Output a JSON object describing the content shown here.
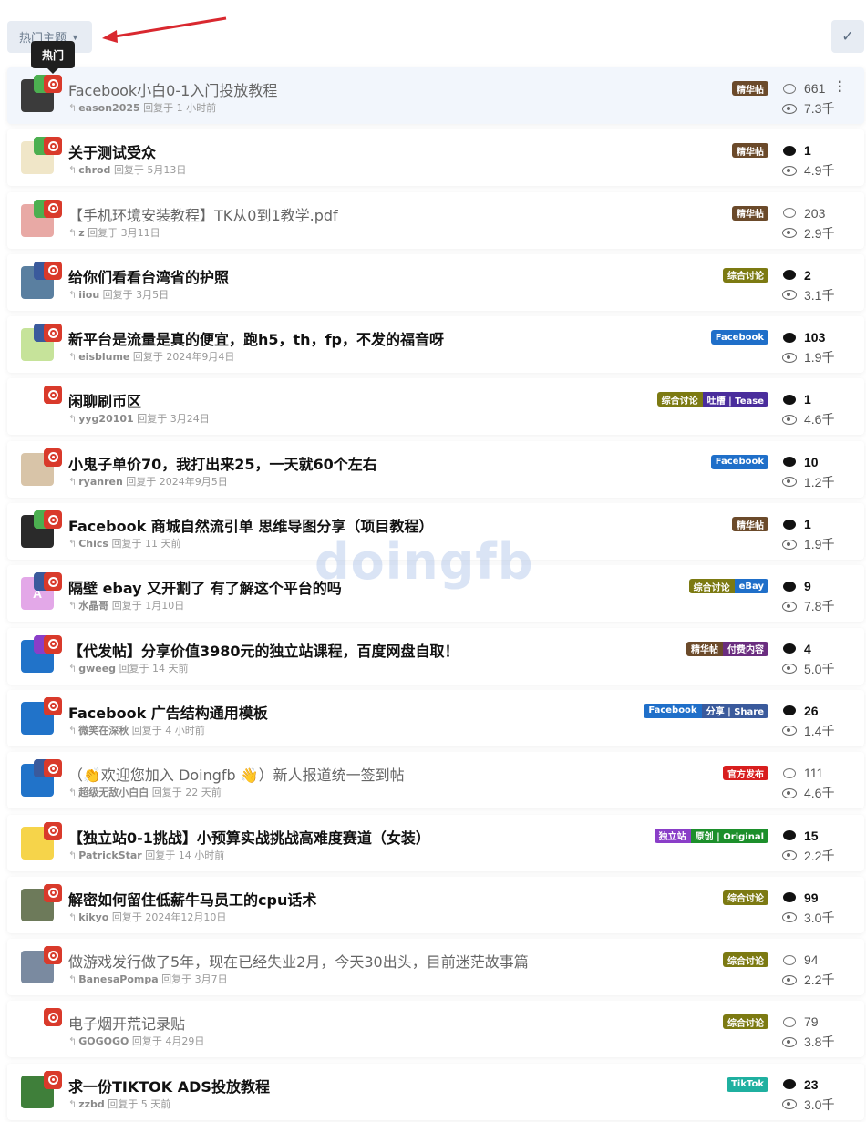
{
  "toolbar": {
    "sort_label": "热门主题",
    "tooltip": "热门"
  },
  "watermark": "doingfb",
  "colors": {
    "hot_badge": "#d93a2b",
    "tag_jinghua": "#6b4a2a",
    "tag_zonghe": "#7c7a12",
    "tag_facebook": "#1f6fc9",
    "tag_tucao": "#4a2d9c",
    "tag_paid": "#6a2d7f",
    "tag_share": "#3a5a9c",
    "tag_ebay": "#1f6fc9",
    "tag_official": "#d81e1e",
    "tag_standalone": "#8a3ec8",
    "tag_original": "#1c8f2b",
    "tag_tiktok": "#1fb0a0"
  },
  "topics": [
    {
      "title": "Facebook小白0-1入门投放教程",
      "user": "eason2025",
      "time": "回复于 1 小时前",
      "tags": [
        "精华帖"
      ],
      "replies": "661",
      "views": "7.3千",
      "read": true,
      "b1": "#4caf50"
    },
    {
      "title": "关于测试受众",
      "user": "chrod",
      "time": "回复于 5月13日",
      "tags": [
        "精华帖"
      ],
      "replies": "1",
      "views": "4.9千",
      "read": false,
      "b1": "#4caf50"
    },
    {
      "title": "【手机环境安装教程】TK从0到1教学.pdf",
      "user": "z",
      "time": "回复于 3月11日",
      "tags": [
        "精华帖"
      ],
      "replies": "203",
      "views": "2.9千",
      "read": true,
      "b1": "#4caf50"
    },
    {
      "title": "给你们看看台湾省的护照",
      "user": "iiou",
      "time": "回复于 3月5日",
      "tags": [
        "综合讨论"
      ],
      "replies": "2",
      "views": "3.1千",
      "read": false,
      "b1": "#3a5a9c"
    },
    {
      "title": "新平台是流量是真的便宜，跑h5，th，fp，不发的福音呀",
      "user": "eisblume",
      "time": "回复于 2024年9月4日",
      "tags": [
        "Facebook"
      ],
      "replies": "103",
      "views": "1.9千",
      "read": false,
      "b1": "#3a5a9c"
    },
    {
      "title": "闲聊刷币区",
      "user": "yyg20101",
      "time": "回复于 3月24日",
      "tags": [
        "综合讨论",
        "吐槽 | Tease"
      ],
      "replies": "1",
      "views": "4.6千",
      "read": false,
      "b1": ""
    },
    {
      "title": "小鬼子单价70，我打出来25，一天就60个左右",
      "user": "ryanren",
      "time": "回复于 2024年9月5日",
      "tags": [
        "Facebook"
      ],
      "replies": "10",
      "views": "1.2千",
      "read": false,
      "b1": ""
    },
    {
      "title": "Facebook 商城自然流引单 思维导图分享（项目教程）",
      "user": "Chics",
      "time": "回复于 11 天前",
      "tags": [
        "精华帖"
      ],
      "replies": "1",
      "views": "1.9千",
      "read": false,
      "b1": "#4caf50"
    },
    {
      "title": "隔壁 ebay 又开割了 有了解这个平台的吗",
      "user": "水晶哥",
      "time": "回复于 1月10日",
      "tags": [
        "综合讨论",
        "eBay"
      ],
      "replies": "9",
      "views": "7.8千",
      "read": false,
      "b1": "#3a5a9c"
    },
    {
      "title": "【代发帖】分享价值3980元的独立站课程，百度网盘自取！",
      "user": "gweeg",
      "time": "回复于 14 天前",
      "tags": [
        "精华帖",
        "付费内容"
      ],
      "replies": "4",
      "views": "5.0千",
      "read": false,
      "b1": "#8a3ec8"
    },
    {
      "title": "Facebook 广告结构通用模板",
      "user": "微笑在深秋",
      "time": "回复于 4 小时前",
      "tags": [
        "Facebook",
        "分享 | Share"
      ],
      "replies": "26",
      "views": "1.4千",
      "read": false,
      "b1": ""
    },
    {
      "title": "（👏欢迎您加入 Doingfb 👋）新人报道统一签到帖",
      "user": "超级无敌小白白",
      "time": "回复于 22 天前",
      "tags": [
        "官方发布"
      ],
      "replies": "111",
      "views": "4.6千",
      "read": true,
      "b1": "#3a5a9c"
    },
    {
      "title": "【独立站0-1挑战】小预算实战挑战高难度赛道（女装）",
      "user": "PatrickStar",
      "time": "回复于 14 小时前",
      "tags": [
        "独立站",
        "原创 | Original"
      ],
      "replies": "15",
      "views": "2.2千",
      "read": false,
      "b1": ""
    },
    {
      "title": "解密如何留住低薪牛马员工的cpu话术",
      "user": "kikyo",
      "time": "回复于 2024年12月10日",
      "tags": [
        "综合讨论"
      ],
      "replies": "99",
      "views": "3.0千",
      "read": false,
      "b1": ""
    },
    {
      "title": "做游戏发行做了5年，现在已经失业2月，今天30出头，目前迷茫故事篇",
      "user": "BanesaPompa",
      "time": "回复于 3月7日",
      "tags": [
        "综合讨论"
      ],
      "replies": "94",
      "views": "2.2千",
      "read": true,
      "b1": ""
    },
    {
      "title": "电子烟开荒记录贴",
      "user": "GOGOGO",
      "time": "回复于 4月29日",
      "tags": [
        "综合讨论"
      ],
      "replies": "79",
      "views": "3.8千",
      "read": true,
      "b1": ""
    },
    {
      "title": "求一份TIKTOK ADS投放教程",
      "user": "zzbd",
      "time": "回复于 5 天前",
      "tags": [
        "TikTok"
      ],
      "replies": "23",
      "views": "3.0千",
      "read": false,
      "b1": ""
    }
  ],
  "avatars": [
    "#3b3b3b",
    "#f0e6c8",
    "#e8a9a5",
    "#5a7fa0",
    "#c6e39a",
    "#ffffff",
    "#d8c4a8",
    "#2a2a2a",
    "#e3a8e8",
    "#2173c9",
    "#2173c9",
    "#2173c9",
    "#f6d44a",
    "#6d7a5a",
    "#7a8aa0",
    "#ffffff",
    "#3f7f3a"
  ],
  "avatar_letters": [
    "",
    "",
    "",
    "",
    "",
    "",
    "",
    "",
    "A",
    "",
    "",
    "",
    "",
    "",
    "",
    "",
    ""
  ]
}
